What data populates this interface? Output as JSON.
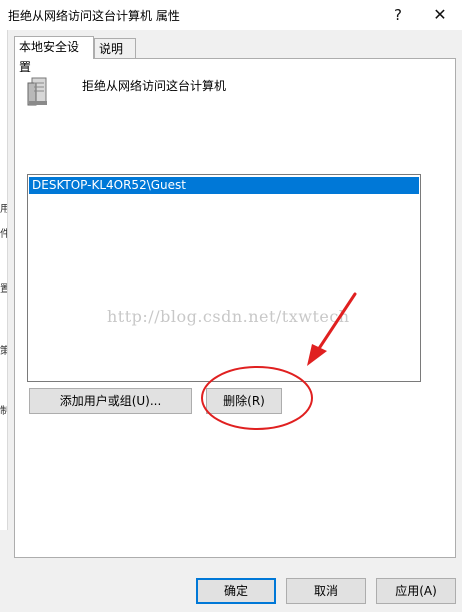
{
  "window": {
    "title": "拒绝从网络访问这台计算机 属性",
    "help_label": "?",
    "close_label": "✕"
  },
  "tabs": [
    {
      "label": "本地安全设置"
    },
    {
      "label": "说明"
    }
  ],
  "policy": {
    "title": "拒绝从网络访问这台计算机",
    "icon": "server-icon"
  },
  "list": {
    "items": [
      "DESKTOP-KL4OR52\\Guest"
    ]
  },
  "watermark": "http://blog.csdn.net/txwtech",
  "buttons": {
    "add": "添加用户或组(U)...",
    "remove": "删除(R)",
    "ok": "确定",
    "cancel": "取消",
    "apply": "应用(A)"
  },
  "left_edge_glyphs": [
    "用",
    "件",
    "置",
    "策",
    "制"
  ],
  "colors": {
    "selection": "#0078d7",
    "annotation": "#e02020"
  }
}
